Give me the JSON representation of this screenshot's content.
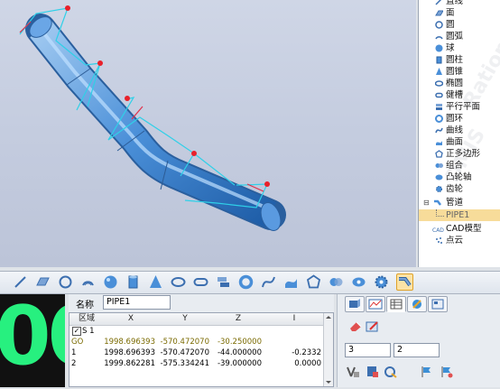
{
  "tree": {
    "items": [
      {
        "label": "直线",
        "icon": "line-icon"
      },
      {
        "label": "面",
        "icon": "plane-icon"
      },
      {
        "label": "圆",
        "icon": "circle-icon"
      },
      {
        "label": "圆弧",
        "icon": "arc-icon"
      },
      {
        "label": "球",
        "icon": "sphere-icon"
      },
      {
        "label": "圆柱",
        "icon": "cylinder-icon"
      },
      {
        "label": "圆锥",
        "icon": "cone-icon"
      },
      {
        "label": "椭圆",
        "icon": "ellipse-icon"
      },
      {
        "label": "健槽",
        "icon": "keyway-icon"
      },
      {
        "label": "平行平面",
        "icon": "parallel-planes-icon"
      },
      {
        "label": "圆环",
        "icon": "torus-icon"
      },
      {
        "label": "曲线",
        "icon": "curve-icon"
      },
      {
        "label": "曲面",
        "icon": "surface-icon"
      },
      {
        "label": "正多边形",
        "icon": "polygon-icon"
      },
      {
        "label": "组合",
        "icon": "group-icon"
      },
      {
        "label": "凸轮轴",
        "icon": "camshaft-icon"
      },
      {
        "label": "齿轮",
        "icon": "gear-icon"
      },
      {
        "label": "管道",
        "icon": "pipe-icon"
      },
      {
        "label": "PIPE1",
        "icon": ""
      },
      {
        "label": "CAD模型",
        "icon": "cad-icon"
      },
      {
        "label": "点云",
        "icon": "point-cloud-icon"
      }
    ],
    "watermark": "Rational DMIS"
  },
  "toolbar": {
    "icons": [
      "line-tool-icon",
      "plane-tool-icon",
      "circle-tool-icon",
      "arc-tool-icon",
      "sphere-tool-icon",
      "cylinder-tool-icon",
      "cone-tool-icon",
      "ellipse-tool-icon",
      "keyway-tool-icon",
      "parallel-planes-tool-icon",
      "torus-tool-icon",
      "curve-tool-icon",
      "surface-tool-icon",
      "polygon-tool-icon",
      "group-tool-icon",
      "camshaft-tool-icon",
      "gear-tool-icon",
      "pipe-tool-icon"
    ]
  },
  "display": {
    "value": "00",
    "color": "#27f07f"
  },
  "detail": {
    "name_label": "名称",
    "name_value": "PIPE1",
    "columns": [
      "区域",
      "X",
      "Y",
      "Z",
      "I"
    ],
    "rows": [
      {
        "c0": "S 1",
        "x": "",
        "y": "",
        "z": "",
        "i": "",
        "checked": true
      },
      {
        "c0": "GO",
        "x": "1998.696393",
        "y": "-570.472070",
        "z": "-30.250000",
        "i": "",
        "color": "#7a6a00"
      },
      {
        "c0": "1",
        "x": "1998.696393",
        "y": "-570.472070",
        "z": "-44.000000",
        "i": "-0.2332",
        "extra": "("
      },
      {
        "c0": "2",
        "x": "1999.862281",
        "y": "-575.334241",
        "z": "-39.000000",
        "i": "0.0000",
        "extra": "-("
      }
    ]
  },
  "props": {
    "field1": "3",
    "field2": "2"
  }
}
